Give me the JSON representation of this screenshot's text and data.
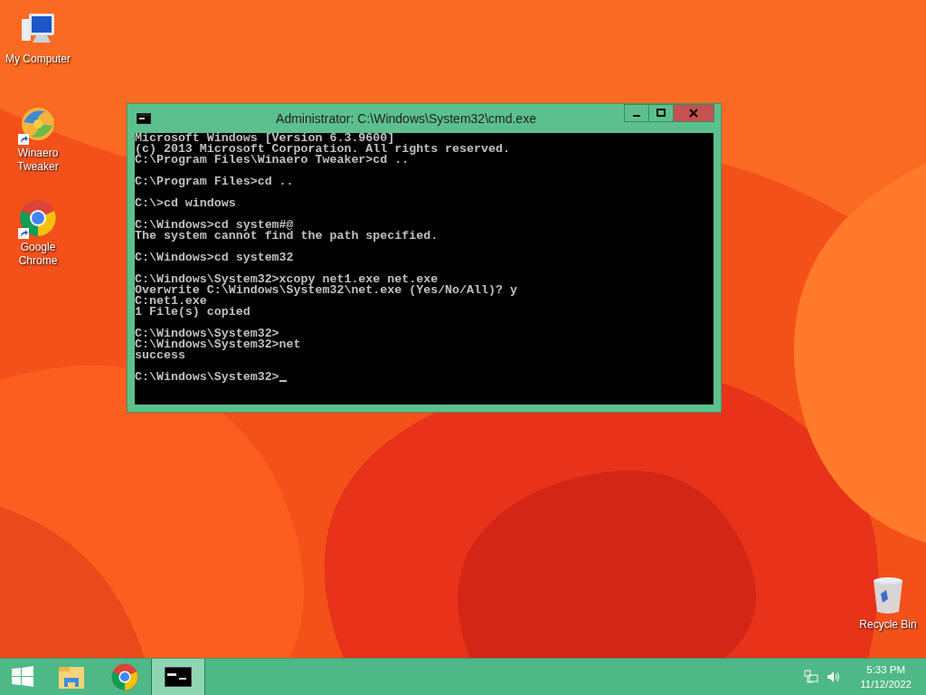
{
  "desktop_icons": [
    {
      "kind": "computer",
      "label": "My Computer",
      "shortcut": false
    },
    {
      "kind": "tweaker",
      "label": "Winaero Tweaker",
      "shortcut": true
    },
    {
      "kind": "chrome",
      "label": "Google Chrome",
      "shortcut": true
    },
    {
      "kind": "recycle",
      "label": "Recycle Bin",
      "shortcut": false
    }
  ],
  "window": {
    "title": "Administrator: C:\\Windows\\System32\\cmd.exe",
    "cursor": true,
    "console_blocks": [
      [
        "Microsoft Windows [Version 6.3.9600]",
        "(c) 2013 Microsoft Corporation. All rights reserved.",
        "C:\\Program Files\\Winaero Tweaker>cd .."
      ],
      [
        "C:\\Program Files>cd .."
      ],
      [
        "C:\\>cd windows"
      ],
      [
        "C:\\Windows>cd system#@",
        "The system cannot find the path specified."
      ],
      [
        "C:\\Windows>cd system32"
      ],
      [
        "C:\\Windows\\System32>xcopy net1.exe net.exe",
        "Overwrite C:\\Windows\\System32\\net.exe (Yes/No/All)? y",
        "C:net1.exe",
        "1 File(s) copied"
      ],
      [
        "C:\\Windows\\System32>",
        "C:\\Windows\\System32>net",
        "success"
      ],
      [
        "C:\\Windows\\System32>"
      ]
    ]
  },
  "taskbar": {
    "items": [
      {
        "kind": "start",
        "selected": false
      },
      {
        "kind": "explorer",
        "selected": false
      },
      {
        "kind": "chrome",
        "selected": false
      },
      {
        "kind": "cmd",
        "selected": true
      }
    ],
    "clock": {
      "time": "5:33 PM",
      "date": "11/12/2022"
    }
  }
}
